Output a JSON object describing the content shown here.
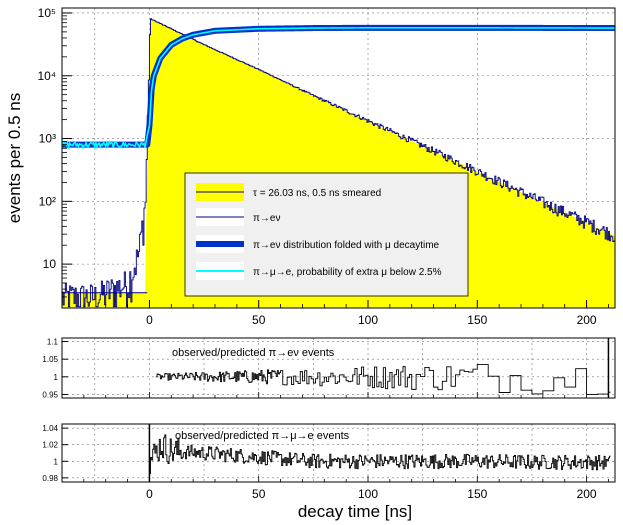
{
  "colors": {
    "fill": "#ffff00",
    "hist": "#000080",
    "folded": "#0033cc",
    "mu": "#00ffff",
    "residual": "#000000",
    "legend_bg": "#f0f0f0",
    "grid": "#777777"
  },
  "chart_data": [
    {
      "type": "line",
      "ylabel": "events per 0.5 ns",
      "yscale": "log",
      "xlim": [
        -40,
        213
      ],
      "ylim": [
        2,
        120000
      ],
      "grid": true,
      "legend_position": "middle-center",
      "x_ticks": [
        "0",
        "50",
        "100",
        "150",
        "200"
      ],
      "y_ticks": [
        "10",
        "10²",
        "10³",
        "10⁴",
        "10⁵"
      ],
      "legend": [
        "τ = 26.03 ns, 0.5 ns smeared",
        "π→eν",
        "π→eν distribution folded with μ decaytime",
        "π→μ→e, probability of extra μ below 2.5%"
      ],
      "series": [
        {
          "name": "τ = 26.03 ns, 0.5 ns smeared",
          "style": "filled",
          "x": [
            -40,
            -2,
            0,
            0.5,
            25,
            50,
            75,
            100,
            125,
            150,
            175,
            200,
            213
          ],
          "values": [
            3.5,
            3.5,
            45000,
            80000,
            31000,
            12500,
            4800,
            1900,
            760,
            300,
            115,
            46,
            28
          ]
        },
        {
          "name": "π→eν",
          "style": "hist",
          "x": [
            -40,
            -25,
            -10,
            -5,
            -2,
            0,
            0.5,
            25,
            50,
            75,
            100,
            125,
            150,
            175,
            200,
            213
          ],
          "values": [
            3,
            3,
            5,
            15,
            100,
            45000,
            80000,
            31000,
            12500,
            4800,
            1900,
            760,
            300,
            115,
            46,
            28
          ]
        },
        {
          "name": "π→eν distribution folded with μ decaytime",
          "style": "thick",
          "x": [
            -40,
            -1,
            0,
            1,
            2,
            5,
            10,
            15,
            20,
            30,
            50,
            75,
            100,
            150,
            213
          ],
          "values": [
            800,
            800,
            1600,
            6000,
            10000,
            19000,
            31000,
            39000,
            45000,
            52000,
            56000,
            57500,
            58000,
            58000,
            57500
          ]
        },
        {
          "name": "π→μ→e, probability of extra μ below 2.5%",
          "style": "thin",
          "x": [
            -40,
            -2,
            0,
            1,
            2,
            5,
            10,
            15,
            20,
            30,
            50,
            75,
            100,
            150,
            213
          ],
          "values": [
            800,
            800,
            1600,
            6000,
            10000,
            19000,
            31000,
            39000,
            45000,
            52000,
            56000,
            57500,
            58000,
            58000,
            57500
          ]
        }
      ]
    },
    {
      "type": "line",
      "title": "observed/predicted π→eν events",
      "xlim": [
        -40,
        213
      ],
      "ylim": [
        0.94,
        1.11
      ],
      "grid": true,
      "y_ticks": [
        "1.1",
        "1.05",
        "1",
        "0.95"
      ],
      "series": [
        {
          "name": "observed/predicted π→eν events",
          "x": [
            0,
            25,
            50,
            75,
            100,
            125,
            150,
            175,
            200,
            213
          ],
          "values": [
            1.0,
            1.0,
            1.0,
            1.0,
            1.0,
            1.0,
            1.0,
            1.0,
            1.0,
            1.0
          ]
        }
      ]
    },
    {
      "type": "line",
      "title": "observed/predicted π→μ→e events",
      "xlabel": "decay time  [ns]",
      "xlim": [
        -40,
        213
      ],
      "ylim": [
        0.975,
        1.045
      ],
      "grid": true,
      "x_ticks": [
        "0",
        "50",
        "100",
        "150",
        "200"
      ],
      "y_ticks": [
        "1.04",
        "1.02",
        "1",
        "0.98"
      ],
      "series": [
        {
          "name": "observed/predicted π→μ→e events",
          "x": [
            0,
            5,
            10,
            25,
            50,
            75,
            100,
            125,
            150,
            175,
            200,
            213
          ],
          "values": [
            1.0,
            1.02,
            1.012,
            1.01,
            1.005,
            1.0,
            1.0,
            1.0,
            1.0,
            0.999,
            0.999,
            0.998
          ]
        }
      ]
    }
  ]
}
